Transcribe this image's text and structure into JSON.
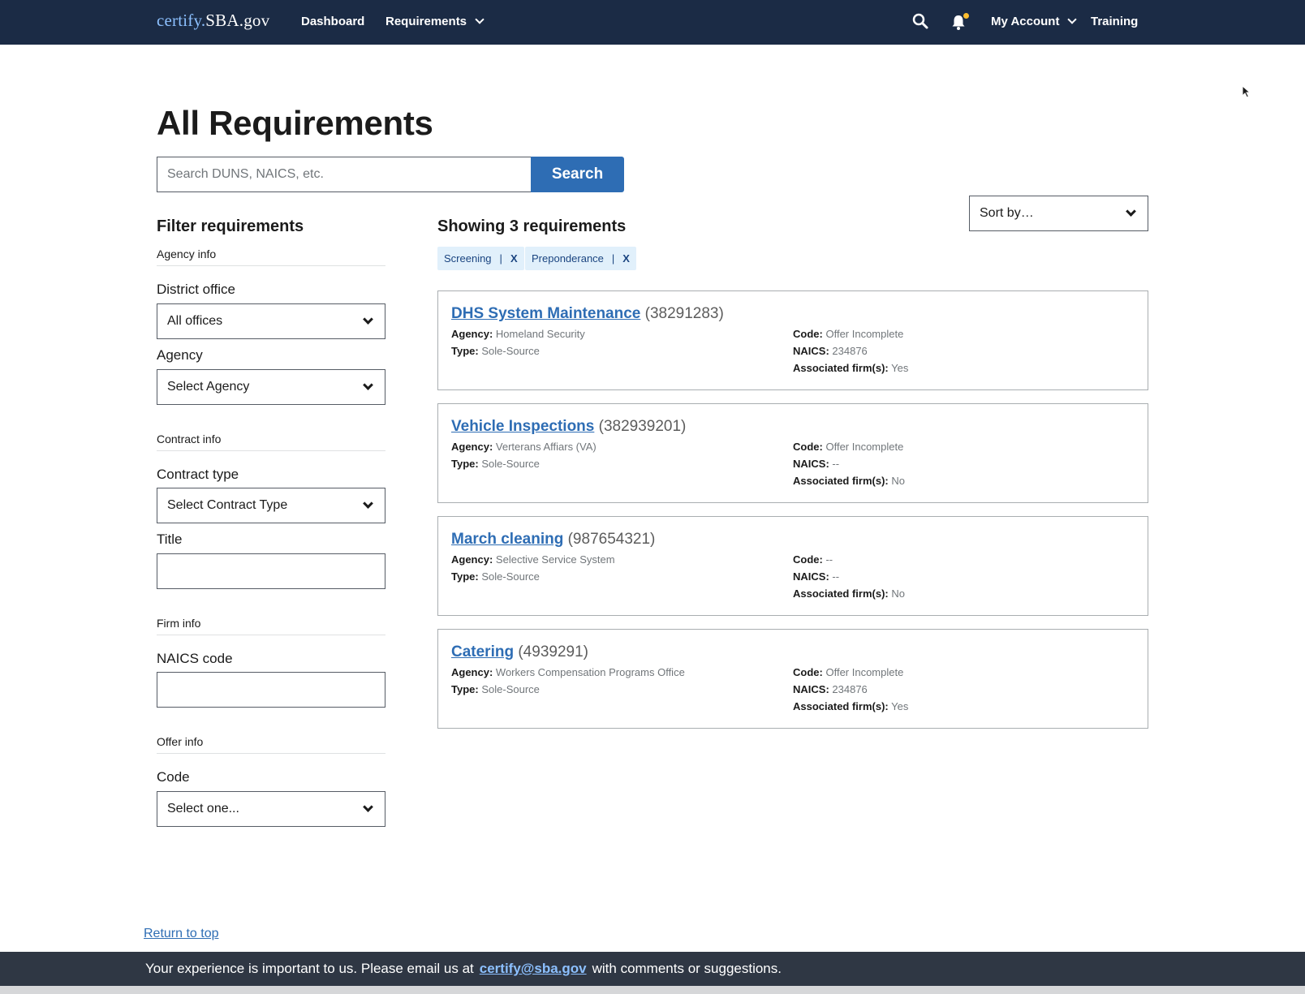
{
  "header": {
    "logo_part1": "certify.",
    "logo_part2": "SBA.gov",
    "nav": {
      "dashboard": "Dashboard",
      "requirements": "Requirements",
      "my_account": "My Account",
      "training": "Training"
    },
    "icons": {
      "search": "search-icon",
      "notifications": "bell-icon",
      "notification_dot_color": "#ffbe2e"
    }
  },
  "page": {
    "title": "All Requirements",
    "search": {
      "placeholder": "Search DUNS, NAICS, etc.",
      "value": "",
      "button": "Search"
    }
  },
  "filters": {
    "title": "Filter requirements",
    "agency_info": {
      "heading": "Agency info",
      "district_office": {
        "label": "District office",
        "value": "All offices"
      },
      "agency": {
        "label": "Agency",
        "value": "Select Agency"
      }
    },
    "contract_info": {
      "heading": "Contract info",
      "contract_type": {
        "label": "Contract type",
        "value": "Select Contract Type"
      },
      "title": {
        "label": "Title",
        "value": ""
      }
    },
    "firm_info": {
      "heading": "Firm info",
      "naics_code": {
        "label": "NAICS code",
        "value": ""
      }
    },
    "offer_info": {
      "heading": "Offer info",
      "code": {
        "label": "Code",
        "value": "Select one..."
      }
    }
  },
  "results": {
    "showing": "Showing 3 requirements",
    "sort": "Sort by…",
    "tags": [
      {
        "label": "Screening",
        "remove": "X"
      },
      {
        "label": "Preponderance",
        "remove": "X"
      }
    ],
    "field_labels": {
      "agency": "Agency:",
      "type": "Type:",
      "code": "Code:",
      "naics": "NAICS:",
      "associated": "Associated firm(s):"
    },
    "items": [
      {
        "name": "DHS System Maintenance",
        "number": "(38291283)",
        "agency": "Homeland Security",
        "type": "Sole-Source",
        "code": "Offer Incomplete",
        "naics": "234876",
        "associated": "Yes"
      },
      {
        "name": "Vehicle Inspections",
        "number": "(382939201)",
        "agency": "Verterans Affiars (VA)",
        "type": "Sole-Source",
        "code": "Offer Incomplete",
        "naics": "--",
        "associated": "No"
      },
      {
        "name": "March cleaning",
        "number": "(987654321)",
        "agency": "Selective Service System",
        "type": "Sole-Source",
        "code": "--",
        "naics": "--",
        "associated": "No"
      },
      {
        "name": "Catering",
        "number": "(4939291)",
        "agency": "Workers Compensation Programs Office",
        "type": "Sole-Source",
        "code": "Offer Incomplete",
        "naics": "234876",
        "associated": "Yes"
      }
    ]
  },
  "footer": {
    "return_to_top": "Return to top",
    "message_before": "Your experience is important to us. Please email us at",
    "email": "certify@sba.gov",
    "message_after": "with comments or suggestions."
  }
}
